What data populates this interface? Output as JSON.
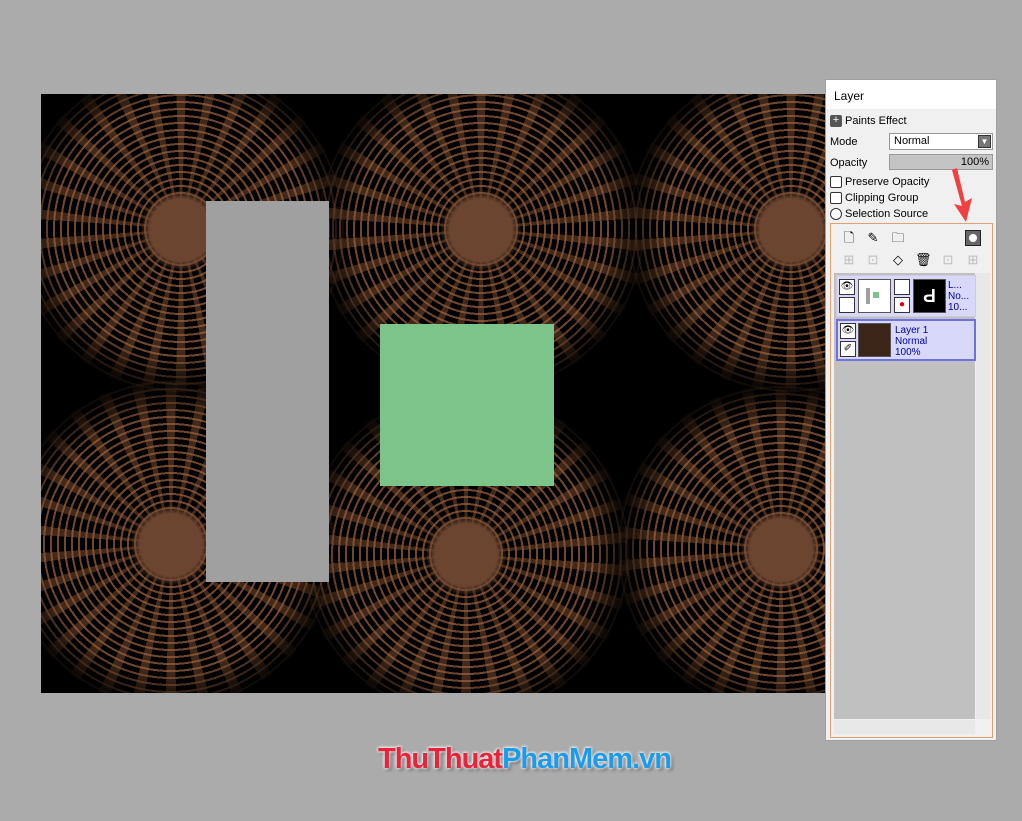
{
  "panel": {
    "title": "Layer",
    "paints_effect": "Paints Effect",
    "mode_label": "Mode",
    "mode_value": "Normal",
    "opacity_label": "Opacity",
    "opacity_value": "100%",
    "preserve_opacity": "Preserve Opacity",
    "clipping_group": "Clipping Group",
    "selection_source": "Selection Source"
  },
  "layers": [
    {
      "name": "L...",
      "mode": "No...",
      "opacity": "10..."
    },
    {
      "name": "Layer 1",
      "mode": "Normal",
      "opacity": "100%"
    }
  ],
  "watermark": {
    "part1": "ThuThuat",
    "part2": "PhanMem",
    "part3": ".vn",
    "color1": "#e8243c",
    "color2": "#1e9be8"
  },
  "canvas": {
    "shape_colors": {
      "gray": "#a0a0a0",
      "green": "#7bc58b"
    }
  }
}
